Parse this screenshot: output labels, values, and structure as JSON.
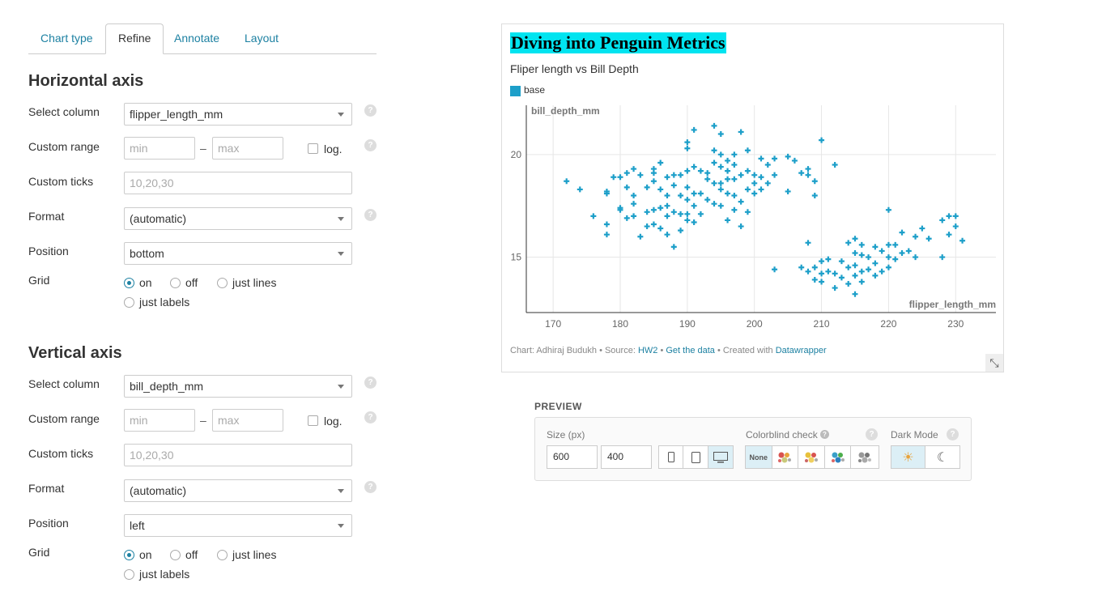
{
  "tabs": [
    "Chart type",
    "Refine",
    "Annotate",
    "Layout"
  ],
  "horizontal_axis": {
    "heading": "Horizontal axis",
    "select_column_label": "Select column",
    "select_column_value": "flipper_length_mm",
    "custom_range_label": "Custom range",
    "min_placeholder": "min",
    "max_placeholder": "max",
    "dash": "–",
    "log_label": "log.",
    "custom_ticks_label": "Custom ticks",
    "custom_ticks_placeholder": "10,20,30",
    "format_label": "Format",
    "format_value": "(automatic)",
    "position_label": "Position",
    "position_value": "bottom",
    "grid_label": "Grid",
    "grid_options": [
      "on",
      "off",
      "just lines",
      "just labels"
    ],
    "grid_selected": "on"
  },
  "vertical_axis": {
    "heading": "Vertical axis",
    "select_column_label": "Select column",
    "select_column_value": "bill_depth_mm",
    "custom_range_label": "Custom range",
    "min_placeholder": "min",
    "max_placeholder": "max",
    "dash": "–",
    "log_label": "log.",
    "custom_ticks_label": "Custom ticks",
    "custom_ticks_placeholder": "10,20,30",
    "format_label": "Format",
    "format_value": "(automatic)",
    "position_label": "Position",
    "position_value": "left",
    "grid_label": "Grid",
    "grid_options": [
      "on",
      "off",
      "just lines",
      "just labels"
    ],
    "grid_selected": "on"
  },
  "help_glyph": "?",
  "chart": {
    "title": "Diving into Penguin Metrics",
    "subtitle": "Fliper length vs Bill Depth",
    "legend_label": "base",
    "footer_prefix": "Chart: Adhiraj Budukh • Source: ",
    "footer_source": "HW2",
    "footer_sep": " • ",
    "footer_getdata": "Get the data",
    "footer_created": " • Created with ",
    "footer_tool": "Datawrapper",
    "expand_glyph": "⤡"
  },
  "chart_data": {
    "type": "scatter",
    "title": "Diving into Penguin Metrics",
    "subtitle": "Fliper length vs Bill Depth",
    "xlabel": "flipper_length_mm",
    "ylabel": "bill_depth_mm",
    "xlim": [
      166,
      236
    ],
    "ylim": [
      12.3,
      22.4
    ],
    "xticks": [
      170,
      180,
      190,
      200,
      210,
      220,
      230
    ],
    "yticks": [
      15,
      20
    ],
    "grid": true,
    "marker": "+",
    "color": "#1d9fc9",
    "series": [
      {
        "name": "base",
        "points": [
          [
            172,
            18.7
          ],
          [
            174,
            18.3
          ],
          [
            176,
            17.0
          ],
          [
            178,
            16.1
          ],
          [
            178,
            16.6
          ],
          [
            178,
            18.1
          ],
          [
            178,
            18.2
          ],
          [
            179,
            18.9
          ],
          [
            180,
            17.3
          ],
          [
            180,
            17.4
          ],
          [
            180,
            18.9
          ],
          [
            181,
            16.9
          ],
          [
            181,
            18.4
          ],
          [
            181,
            19.1
          ],
          [
            182,
            17.0
          ],
          [
            182,
            17.6
          ],
          [
            182,
            18.0
          ],
          [
            182,
            19.3
          ],
          [
            183,
            16.0
          ],
          [
            183,
            19.0
          ],
          [
            184,
            16.5
          ],
          [
            184,
            17.2
          ],
          [
            184,
            18.4
          ],
          [
            185,
            16.6
          ],
          [
            185,
            17.3
          ],
          [
            185,
            18.7
          ],
          [
            185,
            19.3
          ],
          [
            185,
            19.1
          ],
          [
            186,
            16.4
          ],
          [
            186,
            17.4
          ],
          [
            186,
            18.3
          ],
          [
            186,
            19.6
          ],
          [
            187,
            16.1
          ],
          [
            187,
            17.0
          ],
          [
            187,
            17.5
          ],
          [
            187,
            18.0
          ],
          [
            187,
            18.9
          ],
          [
            188,
            15.5
          ],
          [
            188,
            17.2
          ],
          [
            188,
            18.5
          ],
          [
            188,
            19.0
          ],
          [
            189,
            16.3
          ],
          [
            189,
            17.1
          ],
          [
            189,
            18.0
          ],
          [
            189,
            19.0
          ],
          [
            190,
            16.8
          ],
          [
            190,
            17.1
          ],
          [
            190,
            17.8
          ],
          [
            190,
            18.4
          ],
          [
            190,
            19.2
          ],
          [
            190,
            20.3
          ],
          [
            190,
            20.6
          ],
          [
            191,
            16.7
          ],
          [
            191,
            17.5
          ],
          [
            191,
            18.1
          ],
          [
            191,
            19.4
          ],
          [
            191,
            21.2
          ],
          [
            192,
            17.1
          ],
          [
            192,
            18.1
          ],
          [
            192,
            19.2
          ],
          [
            193,
            17.8
          ],
          [
            193,
            18.8
          ],
          [
            193,
            19.1
          ],
          [
            194,
            17.6
          ],
          [
            194,
            18.6
          ],
          [
            194,
            19.6
          ],
          [
            194,
            20.2
          ],
          [
            194,
            21.4
          ],
          [
            195,
            17.5
          ],
          [
            195,
            18.3
          ],
          [
            195,
            18.6
          ],
          [
            195,
            19.4
          ],
          [
            195,
            20.0
          ],
          [
            195,
            21.0
          ],
          [
            196,
            16.8
          ],
          [
            196,
            18.1
          ],
          [
            196,
            18.8
          ],
          [
            196,
            19.2
          ],
          [
            196,
            19.7
          ],
          [
            197,
            17.3
          ],
          [
            197,
            18.0
          ],
          [
            197,
            18.8
          ],
          [
            197,
            19.5
          ],
          [
            197,
            20.0
          ],
          [
            198,
            16.5
          ],
          [
            198,
            17.7
          ],
          [
            198,
            19.0
          ],
          [
            198,
            21.1
          ],
          [
            199,
            17.2
          ],
          [
            199,
            18.3
          ],
          [
            199,
            19.2
          ],
          [
            199,
            20.2
          ],
          [
            200,
            18.1
          ],
          [
            200,
            18.6
          ],
          [
            200,
            19.0
          ],
          [
            201,
            18.3
          ],
          [
            201,
            18.9
          ],
          [
            201,
            19.8
          ],
          [
            202,
            18.6
          ],
          [
            202,
            19.5
          ],
          [
            203,
            19.8
          ],
          [
            203,
            19.0
          ],
          [
            205,
            18.2
          ],
          [
            205,
            19.9
          ],
          [
            206,
            19.7
          ],
          [
            207,
            19.1
          ],
          [
            208,
            19.0
          ],
          [
            208,
            19.3
          ],
          [
            209,
            18.0
          ],
          [
            209,
            18.7
          ],
          [
            210,
            20.7
          ],
          [
            212,
            19.5
          ],
          [
            203,
            14.4
          ],
          [
            207,
            14.5
          ],
          [
            208,
            14.3
          ],
          [
            208,
            15.7
          ],
          [
            209,
            13.9
          ],
          [
            209,
            14.5
          ],
          [
            210,
            13.8
          ],
          [
            210,
            14.2
          ],
          [
            210,
            14.8
          ],
          [
            211,
            14.3
          ],
          [
            211,
            14.9
          ],
          [
            212,
            13.5
          ],
          [
            212,
            14.2
          ],
          [
            213,
            14.0
          ],
          [
            213,
            14.8
          ],
          [
            214,
            13.7
          ],
          [
            214,
            14.5
          ],
          [
            214,
            15.7
          ],
          [
            215,
            13.2
          ],
          [
            215,
            14.1
          ],
          [
            215,
            14.6
          ],
          [
            215,
            15.2
          ],
          [
            215,
            15.9
          ],
          [
            216,
            13.8
          ],
          [
            216,
            14.3
          ],
          [
            216,
            15.1
          ],
          [
            216,
            15.6
          ],
          [
            217,
            14.4
          ],
          [
            217,
            15.0
          ],
          [
            218,
            14.1
          ],
          [
            218,
            14.7
          ],
          [
            218,
            15.5
          ],
          [
            219,
            14.3
          ],
          [
            219,
            15.3
          ],
          [
            220,
            14.5
          ],
          [
            220,
            15.0
          ],
          [
            220,
            15.6
          ],
          [
            220,
            17.3
          ],
          [
            221,
            14.9
          ],
          [
            221,
            15.6
          ],
          [
            222,
            15.2
          ],
          [
            222,
            16.2
          ],
          [
            223,
            15.3
          ],
          [
            224,
            15.0
          ],
          [
            224,
            16.0
          ],
          [
            225,
            16.4
          ],
          [
            226,
            15.9
          ],
          [
            228,
            15.0
          ],
          [
            228,
            16.8
          ],
          [
            229,
            17.0
          ],
          [
            229,
            16.1
          ],
          [
            230,
            16.5
          ],
          [
            230,
            17.0
          ],
          [
            231,
            15.8
          ]
        ]
      }
    ]
  },
  "preview": {
    "heading": "PREVIEW",
    "size_label": "Size (px)",
    "width": "600",
    "height": "400",
    "colorblind_label": "Colorblind check",
    "colorblind_none": "None",
    "dark_mode_label": "Dark Mode",
    "sun_glyph": "☀",
    "moon_glyph": "☾"
  }
}
